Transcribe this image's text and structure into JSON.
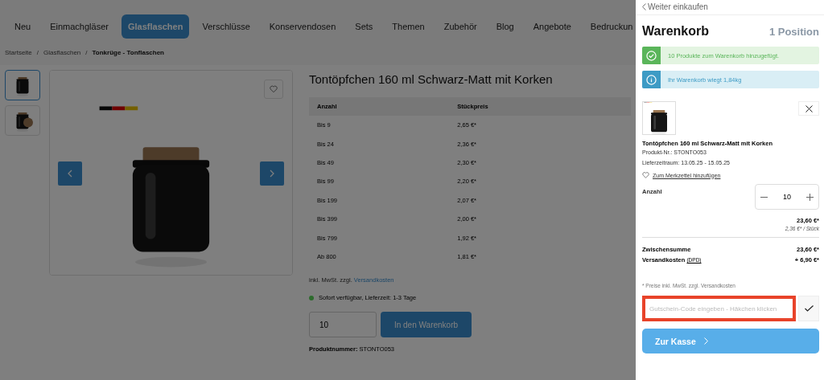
{
  "nav": [
    {
      "label": "Neu",
      "selected": false
    },
    {
      "label": "Einmachgläser",
      "selected": false
    },
    {
      "label": "Glasflaschen",
      "selected": true
    },
    {
      "label": "Verschlüsse",
      "selected": false
    },
    {
      "label": "Konservendosen",
      "selected": false
    },
    {
      "label": "Sets",
      "selected": false
    },
    {
      "label": "Themen",
      "selected": false
    },
    {
      "label": "Zubehör",
      "selected": false
    },
    {
      "label": "Blog",
      "selected": false
    },
    {
      "label": "Angebote",
      "selected": false
    },
    {
      "label": "Bedruckun",
      "selected": false
    }
  ],
  "breadcrumb": [
    {
      "kind": "link",
      "text": "Startseite"
    },
    {
      "kind": "separator",
      "text": "/"
    },
    {
      "kind": "link",
      "text": "Glasflaschen"
    },
    {
      "kind": "separator",
      "text": "/"
    },
    {
      "kind": "current",
      "text": "Tonkrüge - Tonflaschen"
    }
  ],
  "gallery": {
    "thumbnails": [
      {
        "kind": "picture",
        "selected": true
      },
      {
        "kind": "picture",
        "selected": false
      }
    ]
  },
  "product": {
    "title": "Tontöpfchen 160 ml Schwarz-Matt mit Korken",
    "price_table": {
      "columns": [
        "Anzahl",
        "Stückpreis"
      ],
      "rows": [
        [
          "Bis 9",
          "2,65 €*"
        ],
        [
          "Bis 24",
          "2,36 €*"
        ],
        [
          "Bis 49",
          "2,30 €*"
        ],
        [
          "Bis 99",
          "2,20 €*"
        ],
        [
          "Bis 199",
          "2,07 €*"
        ],
        [
          "Bis 399",
          "2,00 €*"
        ],
        [
          "Bis 799",
          "1,92 €*"
        ],
        [
          "Ab 800",
          "1,81 €*"
        ]
      ]
    },
    "tax_note": "inkl. MwSt. zzgl.",
    "tax_link": "Versandkosten",
    "availability": {
      "text": "Sofort verfügbar, Lieferzeit: 1-3 Tage",
      "color": "#2d6b2d"
    },
    "quantity": "10",
    "add_button": "In den Warenkorb",
    "number_label": "Produktnummer:",
    "number": "STONTO053"
  },
  "cart": {
    "back": "Weiter einkaufen",
    "title": "Warenkorb",
    "count": "1 Position",
    "alerts": [
      {
        "kind": "success",
        "text": "10 Produkte zum Warenkorb hinzugefügt."
      },
      {
        "kind": "info",
        "text": "Ihr Warenkorb wiegt 1,84kg"
      }
    ],
    "item": {
      "title": "Tontöpfchen 160 ml Schwarz-Matt mit Korken",
      "number": "Produkt-Nr.: STONTO053",
      "delivery": "Lieferzeitraum: 13.05.25 - 15.05.25",
      "wishlist": "Zum Merkzettel hinzufügen",
      "quantity_label": "Anzahl",
      "quantity": "10",
      "total": "23,60 €*",
      "unit_price": "2,36 €* / Stück"
    },
    "subtotal_label": "Zwischensumme",
    "subtotal": "23,60 €*",
    "shipping_label": "Versandkosten",
    "shipping_carrier": "(DPD)",
    "shipping": "+ 6,90 €*",
    "footnote": "* Preise inkl. MwSt. zzgl. Versandkosten",
    "coupon": {
      "placeholder": "Gutschein-Code eingeben - Häkchen klicken",
      "highlighted": true
    },
    "checkout": "Zur Kasse"
  }
}
